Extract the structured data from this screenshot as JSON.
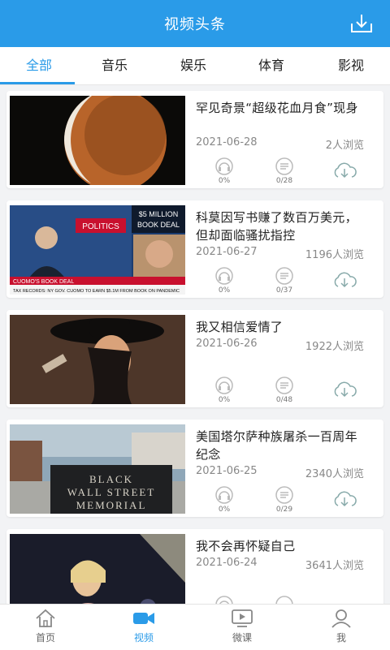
{
  "header": {
    "title": "视频头条"
  },
  "tabs": [
    "全部",
    "音乐",
    "娱乐",
    "体育",
    "影视"
  ],
  "items": [
    {
      "title": "罕见奇景“超级花血月食”现身",
      "date": "2021-06-28",
      "views": "2人浏览",
      "listen": "0%",
      "progress": "0/28"
    },
    {
      "title": "科莫因写书赚了数百万美元，但却面临骚扰指控",
      "date": "2021-06-27",
      "views": "1196人浏览",
      "listen": "0%",
      "progress": "0/37"
    },
    {
      "title": "我又相信爱情了",
      "date": "2021-06-26",
      "views": "1922人浏览",
      "listen": "0%",
      "progress": "0/48"
    },
    {
      "title": "美国塔尔萨种族屠杀一百周年纪念",
      "date": "2021-06-25",
      "views": "2340人浏览",
      "listen": "0%",
      "progress": "0/29"
    },
    {
      "title": "我不会再怀疑自己",
      "date": "2021-06-24",
      "views": "3641人浏览",
      "listen": "",
      "progress": ""
    }
  ],
  "thumb_text": {
    "politics": "POLITICS",
    "money": "$5 MILLION",
    "book": "BOOK DEAL",
    "lower1": "CUOMO'S BOOK DEAL",
    "lower2": "TAX RECORDS: NY GOV. CUOMO TO EARN $5.1M FROM BOOK ON PANDEMIC",
    "memorial1": "BLACK",
    "memorial2": "WALL STREET",
    "memorial3": "MEMORIAL"
  },
  "bottom_nav": [
    "首页",
    "视频",
    "微课",
    "我"
  ],
  "colors": {
    "accent": "#2a9be8",
    "background": "#f2f3f5"
  },
  "icons": {
    "download": "download-icon",
    "headphone": "headphone-icon",
    "play": "play-icon",
    "cloud": "cloud-download-icon"
  }
}
